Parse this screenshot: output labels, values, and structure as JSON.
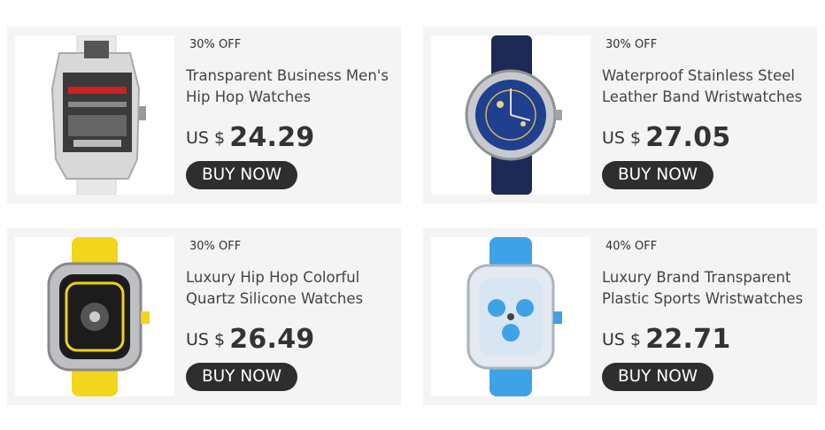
{
  "products": [
    {
      "discount": "30% OFF",
      "title": "Transparent Business Men's Hip Hop Watches",
      "currency": "US $",
      "price": "24.29",
      "button": "BUY NOW"
    },
    {
      "discount": "30% OFF",
      "title": "Waterproof Stainless Steel Leather Band Wristwatches",
      "currency": "US $",
      "price": "27.05",
      "button": "BUY NOW"
    },
    {
      "discount": "30% OFF",
      "title": "Luxury Hip Hop Colorful Quartz Silicone Watches",
      "currency": "US $",
      "price": "26.49",
      "button": "BUY NOW"
    },
    {
      "discount": "40% OFF",
      "title": "Luxury Brand Transparent Plastic Sports Wristwatches",
      "currency": "US $",
      "price": "22.71",
      "button": "BUY NOW"
    }
  ],
  "colors": {
    "card_bg": "#f4f4f4",
    "button_bg": "#2e2e2e",
    "button_text": "#ffffff"
  }
}
